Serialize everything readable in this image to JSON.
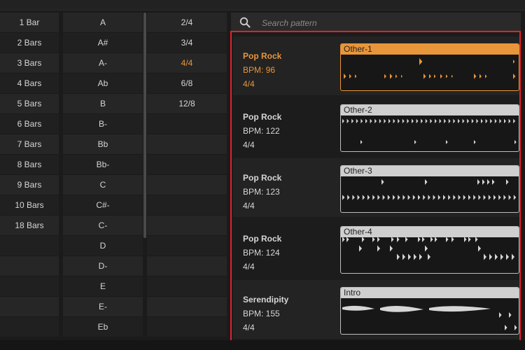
{
  "bars_column": [
    "1 Bar",
    "2 Bars",
    "3 Bars",
    "4 Bars",
    "5 Bars",
    "6 Bars",
    "7 Bars",
    "8 Bars",
    "9 Bars",
    "10 Bars",
    "18 Bars",
    "",
    "",
    "",
    "",
    ""
  ],
  "key_column": [
    "A",
    "A#",
    "A-",
    "Ab",
    "B",
    "B-",
    "Bb",
    "Bb-",
    "C",
    "C#-",
    "C-",
    "D",
    "D-",
    "E",
    "E-",
    "Eb"
  ],
  "time_column": [
    "2/4",
    "3/4",
    "4/4",
    "6/8",
    "12/8",
    "",
    "",
    "",
    "",
    "",
    "",
    "",
    "",
    "",
    "",
    ""
  ],
  "time_selected": "4/4",
  "search": {
    "placeholder": "Search pattern",
    "icon": "search-icon"
  },
  "accent_color": "#e8963a",
  "highlight_color": "#e5202a",
  "patterns": [
    {
      "name": "Pop Rock",
      "bpm": "BPM: 96",
      "sig": "4/4",
      "preview": "Other-1",
      "selected": true
    },
    {
      "name": "Pop Rock",
      "bpm": "BPM: 122",
      "sig": "4/4",
      "preview": "Other-2",
      "selected": false
    },
    {
      "name": "Pop Rock",
      "bpm": "BPM: 123",
      "sig": "4/4",
      "preview": "Other-3",
      "selected": false
    },
    {
      "name": "Pop Rock",
      "bpm": "BPM: 124",
      "sig": "4/4",
      "preview": "Other-4",
      "selected": false
    },
    {
      "name": "Serendipity",
      "bpm": "BPM: 155",
      "sig": "4/4",
      "preview": "Intro",
      "selected": false
    }
  ]
}
